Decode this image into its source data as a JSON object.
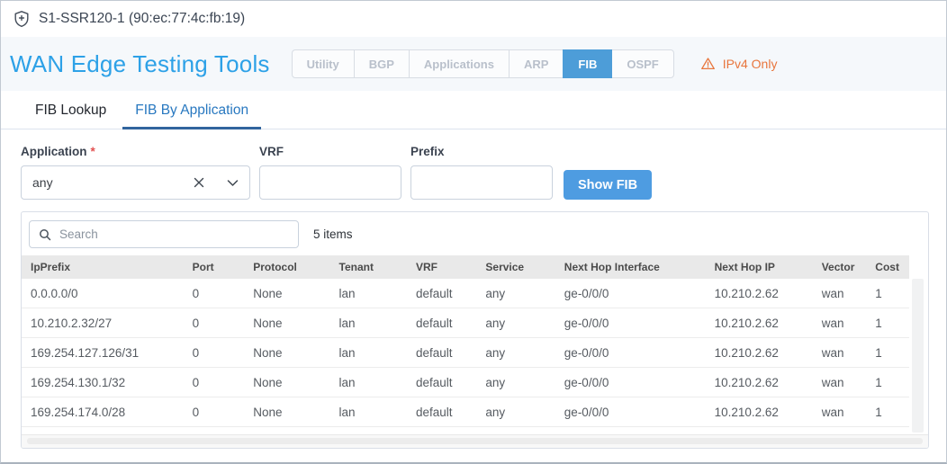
{
  "topbar": {
    "device_name": "S1-SSR120-1 (90:ec:77:4c:fb:19)"
  },
  "header": {
    "title": "WAN Edge Testing Tools",
    "tabs": [
      {
        "label": "Utility",
        "active": false
      },
      {
        "label": "BGP",
        "active": false
      },
      {
        "label": "Applications",
        "active": false
      },
      {
        "label": "ARP",
        "active": false
      },
      {
        "label": "FIB",
        "active": true
      },
      {
        "label": "OSPF",
        "active": false
      }
    ],
    "warning_label": "IPv4 Only"
  },
  "subtabs": [
    {
      "label": "FIB Lookup",
      "active": false
    },
    {
      "label": "FIB By Application",
      "active": true
    }
  ],
  "form": {
    "application_label": "Application",
    "required_marker": "*",
    "application_value": "any",
    "vrf_label": "VRF",
    "vrf_value": "",
    "prefix_label": "Prefix",
    "prefix_value": "",
    "show_fib_label": "Show FIB"
  },
  "table": {
    "search_placeholder": "Search",
    "items_count_label": "5 items",
    "columns": [
      "IpPrefix",
      "Port",
      "Protocol",
      "Tenant",
      "VRF",
      "Service",
      "Next Hop Interface",
      "Next Hop IP",
      "Vector",
      "Cost"
    ],
    "rows": [
      [
        "0.0.0.0/0",
        "0",
        "None",
        "lan",
        "default",
        "any",
        "ge-0/0/0",
        "10.210.2.62",
        "wan",
        "1"
      ],
      [
        "10.210.2.32/27",
        "0",
        "None",
        "lan",
        "default",
        "any",
        "ge-0/0/0",
        "10.210.2.62",
        "wan",
        "1"
      ],
      [
        "169.254.127.126/31",
        "0",
        "None",
        "lan",
        "default",
        "any",
        "ge-0/0/0",
        "10.210.2.62",
        "wan",
        "1"
      ],
      [
        "169.254.130.1/32",
        "0",
        "None",
        "lan",
        "default",
        "any",
        "ge-0/0/0",
        "10.210.2.62",
        "wan",
        "1"
      ],
      [
        "169.254.174.0/28",
        "0",
        "None",
        "lan",
        "default",
        "any",
        "ge-0/0/0",
        "10.210.2.62",
        "wan",
        "1"
      ]
    ]
  },
  "colors": {
    "title_blue": "#2da1e7",
    "active_tab_blue": "#4d9dd8",
    "button_blue": "#4e9ce1",
    "subtab_blue": "#2878c0",
    "subtab_underline": "#31659e",
    "warning_orange": "#e8763d",
    "band_bg": "#f5f8fb",
    "table_header_bg": "#e9e9e9"
  }
}
